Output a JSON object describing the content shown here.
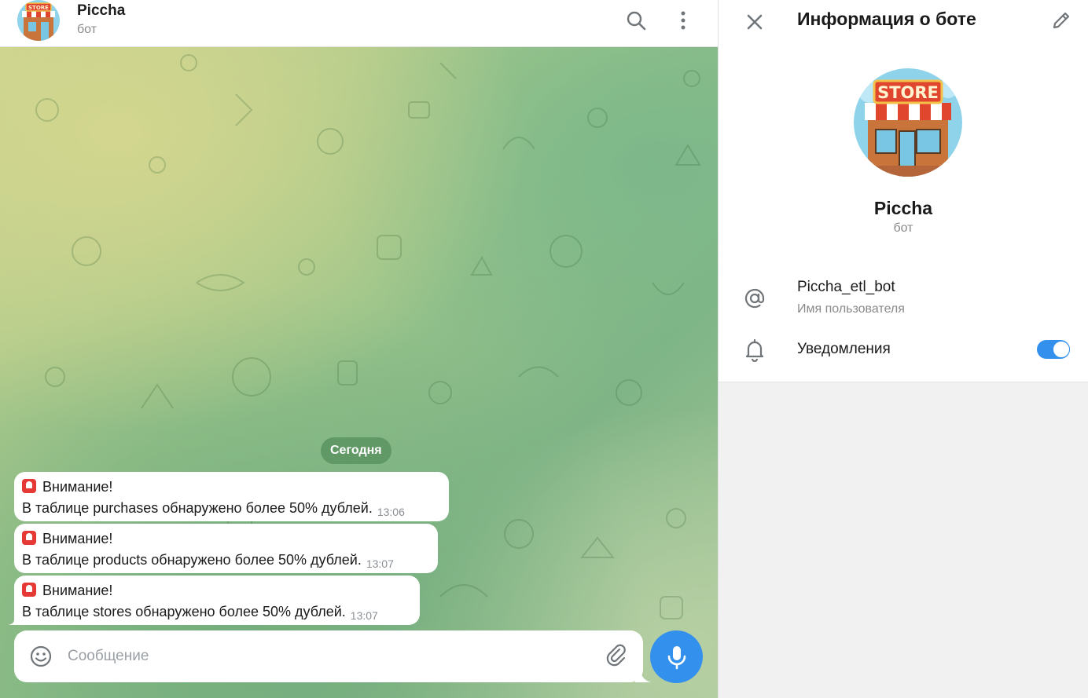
{
  "chat": {
    "title": "Piccha",
    "subtitle": "бот",
    "date_separator": "Сегодня",
    "messages": [
      {
        "heading": "Внимание!",
        "text": "В таблице purchases обнаружено более 50% дублей.",
        "time": "13:06"
      },
      {
        "heading": "Внимание!",
        "text": "В таблице products обнаружено более 50% дублей.",
        "time": "13:07"
      },
      {
        "heading": "Внимание!",
        "text": "В таблице stores обнаружено более 50% дублей.",
        "time": "13:07"
      }
    ],
    "composer_placeholder": "Сообщение"
  },
  "avatar": {
    "logo_text": "STORE"
  },
  "panel": {
    "title": "Информация о боте",
    "name": "Piccha",
    "subtitle": "бот",
    "username": "Piccha_etl_bot",
    "username_label": "Имя пользователя",
    "notifications_label": "Уведомления",
    "notifications_enabled": true
  },
  "colors": {
    "accent": "#3390ec",
    "alarm": "#e53935",
    "date_pill": "#548d5c"
  },
  "icons": [
    "search-icon",
    "more-vertical-icon",
    "close-icon",
    "edit-pencil-icon",
    "at-sign-icon",
    "bell-icon",
    "emoji-icon",
    "paperclip-icon",
    "microphone-icon",
    "alarm-siren-icon"
  ]
}
